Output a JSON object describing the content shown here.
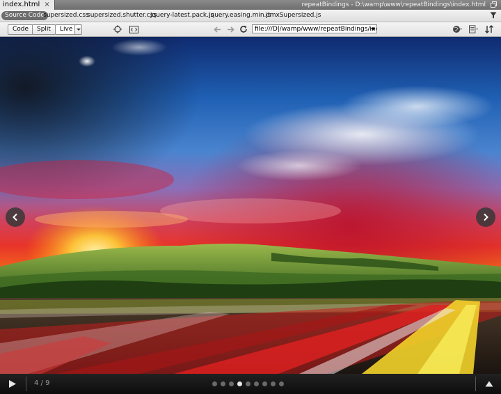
{
  "tabbar": {
    "active_tab": "index.html",
    "close_glyph": "×",
    "document_path": "repeatBindings - D:\\wamp\\www\\repeatBindings\\index.html"
  },
  "related_files": {
    "source_label": "Source Code",
    "files": [
      "supersized.css",
      "supersized.shutter.css",
      "jquery-latest.pack.js",
      "jquery.easing.min.js",
      "dmxSupersized.js"
    ]
  },
  "toolbar": {
    "code_label": "Code",
    "split_label": "Split",
    "live_label": "Live",
    "address_value": "file:///D|/wamp/www/repeatBindings/index.htm"
  },
  "slideshow": {
    "counter": "4 / 9",
    "slide_count": 9,
    "current_slide": 4
  },
  "colors": {
    "tab_bar": "#6e6e6e",
    "toolbar": "#e8e8e8",
    "control_bar": "#141414"
  }
}
